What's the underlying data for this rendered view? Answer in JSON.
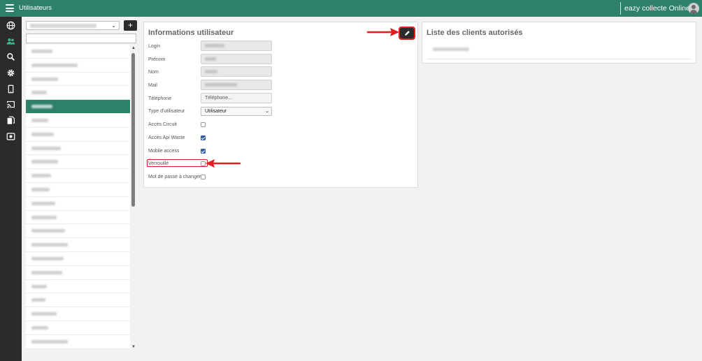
{
  "topbar": {
    "title": "Utilisateurs",
    "app_name": "eazy collecte Online"
  },
  "rail": {
    "icons": [
      "globe-icon",
      "users-icon",
      "search-icon",
      "gear-icon",
      "mobile-icon",
      "cast-icon",
      "documents-icon",
      "display-icon"
    ]
  },
  "user_list": {
    "add_label": "+",
    "row_count": 23,
    "selected_index": 4
  },
  "info_panel": {
    "title": "Informations utilisateur",
    "fields": {
      "login_label": "Login",
      "prenom_label": "Prénom",
      "nom_label": "Nom",
      "mail_label": "Mail",
      "telephone_label": "Téléphone",
      "telephone_placeholder": "Téléphone...",
      "type_label": "Type d'utilisateur",
      "type_value": "Utilisateur",
      "acces_circuit_label": "Accès Circuit",
      "acces_api_label": "Accès Api Waste",
      "mobile_access_label": "Mobile access",
      "verrouille_label": "Verrouillé",
      "mdp_label": "Mot de passe à changer"
    },
    "checkboxes": {
      "acces_circuit": false,
      "acces_api_waste": true,
      "mobile_access": true,
      "verrouille": false,
      "mot_de_passe_a_changer": false
    }
  },
  "clients_panel": {
    "title": "Liste des clients autorisés"
  },
  "colors": {
    "brand_green": "#2e8068",
    "rail_dark": "#2b2b2b",
    "annotation_red": "#e02020",
    "checkbox_blue": "#2f5fa5"
  }
}
